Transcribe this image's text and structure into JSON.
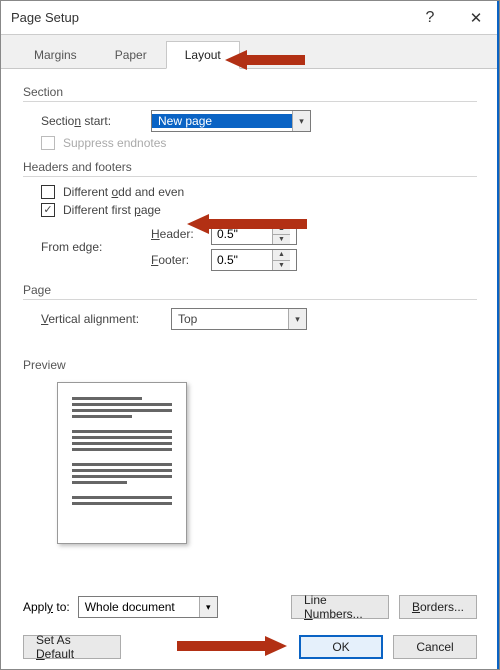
{
  "title": "Page Setup",
  "tabs": {
    "margins": "Margins",
    "paper": "Paper",
    "layout": "Layout"
  },
  "section": {
    "group": "Section",
    "start_label": "Section start:",
    "start_value": "New page",
    "suppress": "Suppress endnotes"
  },
  "hf": {
    "group": "Headers and footers",
    "diff_odd": "Different odd and even",
    "diff_first": "Different first page",
    "from_edge": "From edge:",
    "header_label": "Header:",
    "footer_label": "Footer:",
    "header_val": "0.5\"",
    "footer_val": "0.5\""
  },
  "page": {
    "group": "Page",
    "valign_label": "Vertical alignment:",
    "valign_value": "Top"
  },
  "preview": {
    "group": "Preview"
  },
  "apply": {
    "label": "Apply to:",
    "value": "Whole document",
    "linenumbers": "Line Numbers...",
    "borders": "Borders..."
  },
  "footer": {
    "setdefault": "Set As Default",
    "ok": "OK",
    "cancel": "Cancel"
  },
  "glyph": {
    "help": "?",
    "close": "✕",
    "chev": "▾",
    "check": "✓",
    "up": "▲",
    "down": "▼"
  }
}
